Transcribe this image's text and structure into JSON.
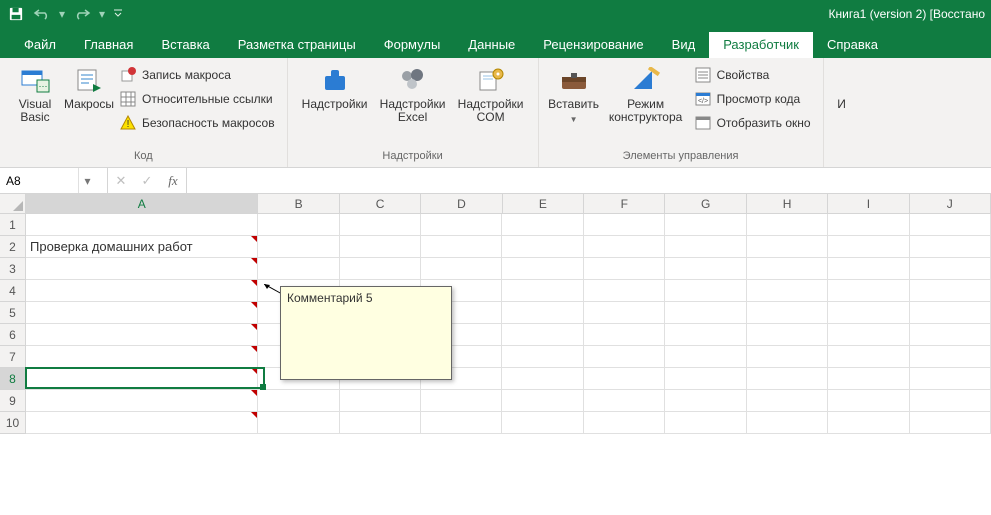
{
  "title": "Книга1 (version 2) [Восстано",
  "tabs": [
    "Файл",
    "Главная",
    "Вставка",
    "Разметка страницы",
    "Формулы",
    "Данные",
    "Рецензирование",
    "Вид",
    "Разработчик",
    "Справка"
  ],
  "active_tab": 8,
  "ribbon": {
    "code": {
      "visual_basic": "Visual Basic",
      "macros": "Макросы",
      "record": "Запись макроса",
      "relative": "Относительные ссылки",
      "security": "Безопасность макросов",
      "group": "Код"
    },
    "addins": {
      "addins": "Надстройки",
      "excel": "Надстройки Excel",
      "com": "Надстройки COM",
      "group": "Надстройки"
    },
    "controls": {
      "insert": "Вставить",
      "design": "Режим конструктора",
      "properties": "Свойства",
      "view_code": "Просмотр кода",
      "show_window": "Отобразить окно",
      "group": "Элементы управления"
    },
    "xml_cut": "И"
  },
  "namebox": "A8",
  "formula": "",
  "columns": [
    "A",
    "B",
    "C",
    "D",
    "E",
    "F",
    "G",
    "H",
    "I",
    "J"
  ],
  "rows": [
    "1",
    "2",
    "3",
    "4",
    "5",
    "6",
    "7",
    "8",
    "9",
    "10"
  ],
  "cell_a2": "Проверка домашних работ",
  "comment_text": "Комментарий 5",
  "selected_row": 8,
  "selected_col": 0
}
